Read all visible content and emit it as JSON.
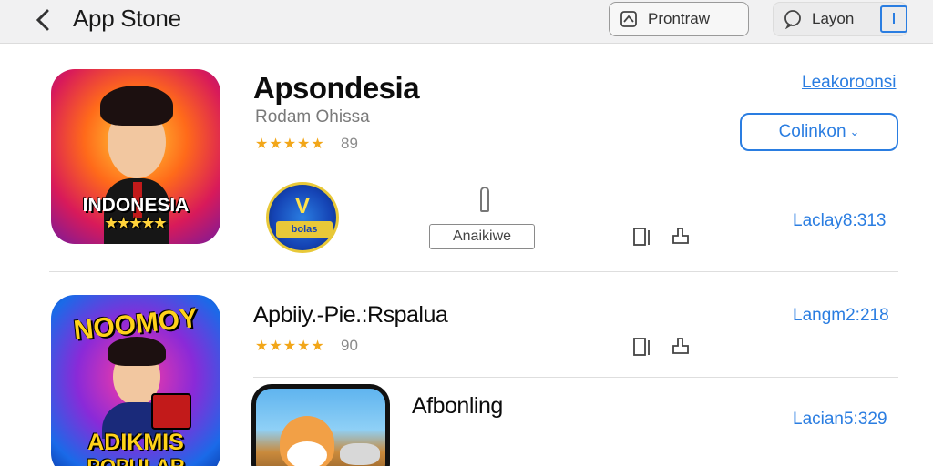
{
  "topbar": {
    "title": "App Stone",
    "preview_label": "Prontraw",
    "layout_label": "Layon"
  },
  "apps": [
    {
      "title": "Apsondesia",
      "subtitle": "Rodam Ohissa",
      "stars": "★★★★★",
      "rating_count": "89",
      "icon_caption": "INDONESIA",
      "icon_stars": "★★★★★",
      "top_link": "Leakoroonsi",
      "collect_button": "Colinkon",
      "badge_v": "V",
      "badge_text": "bolas",
      "secondary_button": "Anaikiwe",
      "side_link": "Laclay8:313"
    },
    {
      "title": "Apbiiy.-Pie.:Rspalua",
      "stars": "★★★★★",
      "rating_count": "90",
      "icon_caption_top": "NOOMOY",
      "icon_caption_bottom": "ADIKMIS",
      "icon_caption_bottom2": "POPULAR",
      "side_link": "Langm2:218"
    },
    {
      "title": "Afbonling",
      "side_link": "Laciаn5:329"
    }
  ]
}
